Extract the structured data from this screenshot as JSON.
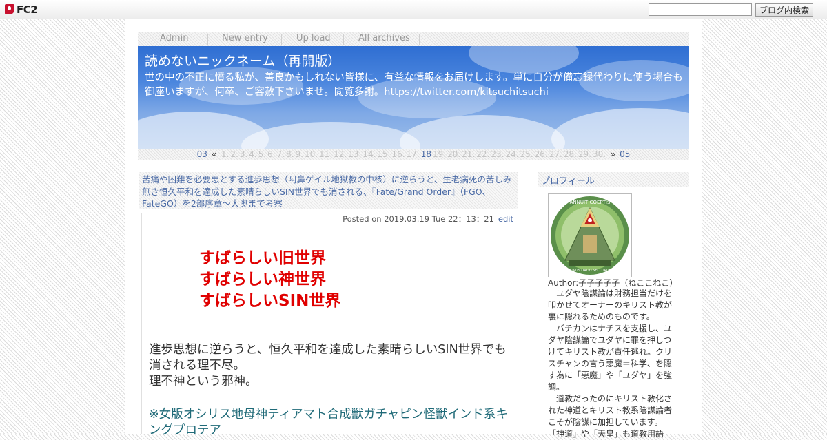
{
  "fc2": {
    "logo_text": "FC2",
    "search_placeholder": "",
    "search_button": "ブログ内検索"
  },
  "nav": [
    "Admin",
    "New entry",
    "Up load",
    "All archives"
  ],
  "blog": {
    "title": "読めないニックネーム（再開版）",
    "description": "世の中の不正に憤る私が、善良かもしれない皆様に、有益な情報をお届けします。単に自分が備忘録代わりに使う場合も御座いますが、何卒、ご容赦下さいませ。閲覧多謝。https://twitter.com/kitsuchitsuchi"
  },
  "calendar": {
    "prev_month": "03",
    "prev_arrow": "«",
    "days": [
      "1.",
      "2.",
      "3.",
      "4.",
      "5.",
      "6.",
      "7.",
      "8.",
      "9.",
      "10.",
      "11.",
      "12.",
      "13.",
      "14.",
      "15.",
      "16.",
      "17.",
      "18",
      "19.",
      "20.",
      "21.",
      "22.",
      "23.",
      "24.",
      "25.",
      "26.",
      "27.",
      "28.",
      "29.",
      "30."
    ],
    "active_day": "18",
    "next_arrow": "»",
    "next_month": "05"
  },
  "entry": {
    "title": "苦痛や困難を必要悪とする進歩思想（阿鼻ゲイル地獄教の中核）に逆らうと、生老病死の苦しみ無き恒久平和を達成した素晴らしいSIN世界でも消される、『Fate/Grand Order』（FGO、FateGO）を2部序章～大奥まで考察",
    "posted": "Posted on 2019.03.19 Tue 22：13：21",
    "edit": "edit",
    "red_lines": [
      "すばらしい旧世界",
      "すばらしい神世界",
      "すばらしいSIN世界"
    ],
    "body_lines": [
      "進歩思想に逆らうと、恒久平和を達成した素晴らしいSIN世界でも消される理不尽。",
      "理不神という邪神。"
    ],
    "link_text": "※女版オシリス地母神ティアマト合成獣ガチャピン怪獣インド系キングプロテア",
    "red_color": "#e00000",
    "link_color": "#1f6a78"
  },
  "sidebar": {
    "profile_title": "プロフィール",
    "avatar_text_top": "ANNUIT COEPTIS",
    "avatar_text_bottom": "NOVUS ORDO SECLORUM",
    "author": "Author:子子子子子（ねここねこ）",
    "profile_paragraphs": [
      "　ユダヤ陰謀論は財務担当だけを叩かせてオーナーのキリスト教が裏に隠れるためのものです。",
      "　バチカンはナチスを支援し、ユダヤ陰謀論でユダヤに罪を押しつけてキリスト教が責任逃れ。クリスチャンの言う悪魔＝科学、を隠す為に「悪魔」や「ユダヤ」を強調。",
      "　道教だったのにキリスト教化された神道とキリスト教系陰謀論者こそが陰謀に加担しています。",
      "「神道」や「天皇」も道教用語"
    ]
  }
}
